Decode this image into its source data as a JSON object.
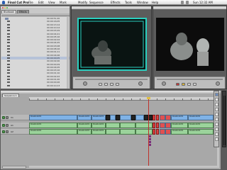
{
  "menubar": {
    "app": "Final Cut Pro",
    "items": [
      "File",
      "Edit",
      "View",
      "Mark",
      "Modify",
      "Sequence",
      "Effects",
      "Tools",
      "Window",
      "Help"
    ],
    "clock": "Sun 12:32 AM"
  },
  "browser": {
    "tabs": [
      "Bluebook",
      "Effects"
    ],
    "active_tab": "Bluebook",
    "clips": [
      {
        "name": "",
        "duration": "00:00:51;20",
        "kind": "bin"
      },
      {
        "name": "",
        "duration": "00:00:16;05",
        "kind": "clip"
      },
      {
        "name": "",
        "duration": "00:00:13;14",
        "kind": "clip"
      },
      {
        "name": "",
        "duration": "00:00:10;14",
        "kind": "clip"
      },
      {
        "name": "",
        "duration": "00:00:03;29",
        "kind": "clip"
      },
      {
        "name": "",
        "duration": "00:00:04;21",
        "kind": "clip"
      },
      {
        "name": "",
        "duration": "00:00:05;16",
        "kind": "clip"
      },
      {
        "name": "",
        "duration": "00:00:02;04",
        "kind": "clip"
      },
      {
        "name": "",
        "duration": "00:00:04;25",
        "kind": "clip"
      },
      {
        "name": "",
        "duration": "00:00:03;08",
        "kind": "clip"
      },
      {
        "name": "",
        "duration": "00:00:08;16",
        "kind": "clip"
      },
      {
        "name": "",
        "duration": "00:00:01;11",
        "kind": "clip"
      },
      {
        "name": "",
        "duration": "00:00:04;06",
        "kind": "clip"
      },
      {
        "name": "",
        "duration": "00:00:00;05",
        "kind": "clip"
      },
      {
        "name": "",
        "duration": "00:00:02;00",
        "kind": "clip"
      },
      {
        "name": "",
        "duration": "00:00:00;29",
        "kind": "clip"
      },
      {
        "name": "",
        "duration": "00:00:04;05",
        "kind": "clip"
      },
      {
        "name": "",
        "duration": "00:00:03;16",
        "kind": "clip"
      },
      {
        "name": "",
        "duration": "00:00:01;10",
        "kind": "clip"
      },
      {
        "name": "",
        "duration": "00:00:02;22",
        "kind": "clip"
      },
      {
        "name": "",
        "duration": "00:00:01;20",
        "kind": "clip"
      },
      {
        "name": "",
        "duration": "00:00:00;26",
        "kind": "clip"
      },
      {
        "name": "",
        "duration": "00:00:10;13",
        "kind": "clip"
      }
    ],
    "selected_index": 13
  },
  "timeline": {
    "sequence_tab": "Sequence 1",
    "tracks": [
      {
        "label": "V1",
        "kind": "video"
      },
      {
        "label": "A1",
        "kind": "audio"
      },
      {
        "label": "A2",
        "kind": "audio"
      }
    ],
    "clip_label": "bluebook01"
  },
  "colors": {
    "video_clip": "#7fb2e6",
    "audio_clip": "#9bd39b",
    "accent_red": "#e04040",
    "canvas_border": "#2ad0c0"
  },
  "icons": [
    "apple-icon",
    "search-icon",
    "play-icon",
    "stop-icon",
    "mark-in-icon",
    "mark-out-icon",
    "razor-tool-icon",
    "selection-tool-icon"
  ]
}
